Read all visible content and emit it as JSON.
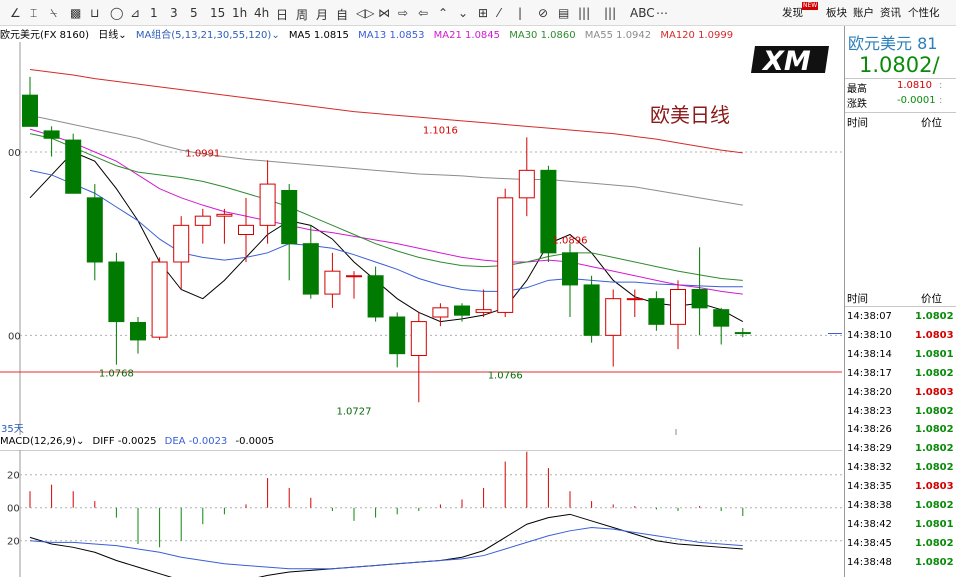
{
  "toolbar": {
    "tools": [
      "∠",
      "⌶",
      "⍀",
      "▩",
      "⊔",
      "◯",
      "⊿",
      "1",
      "3",
      "5",
      "15",
      "1h",
      "4h",
      "日",
      "周",
      "月",
      "自",
      "◁▷",
      "⋈",
      "⇨",
      "⇦",
      "⌃",
      "⌄",
      "⊞",
      "⁄",
      "|",
      "⊘",
      "▤",
      "|||",
      "|||",
      "ABC",
      "⋯"
    ],
    "discover": "发现",
    "badge": "NEW",
    "sectors": "板块",
    "account": "账户",
    "news": "资讯",
    "personal": "个性化"
  },
  "infobar": {
    "symbol": "欧元美元(FX 8160)",
    "period": "日线",
    "ma_group": "MA组合(5,13,21,30,55,120)",
    "ma5": "MA5 1.0815",
    "ma13": "MA13 1.0853",
    "ma21": "MA21 1.0845",
    "ma30": "MA30 1.0860",
    "ma55": "MA55 1.0942",
    "ma120": "MA120 1.0999"
  },
  "watermark": {
    "logo": "XM",
    "title": "欧美日线"
  },
  "macd_header": {
    "label": "MACD(12,26,9)",
    "diff": "DIFF -0.0025",
    "dea": "DEA -0.0023",
    "value": "-0.0005"
  },
  "right_panel": {
    "name": "欧元美元",
    "code_frag": "81",
    "price": "1.0802",
    "high_label": "最高",
    "high_value": "1.0810",
    "change_label": "涨跌",
    "change_value": "-0.0001",
    "header1": {
      "time": "时间",
      "price": "价位"
    },
    "header2": {
      "time": "时间",
      "price": "价位"
    },
    "ticks": [
      {
        "time": "14:38:07",
        "price": "1.0802"
      },
      {
        "time": "14:38:10",
        "price": "1.0803"
      },
      {
        "time": "14:38:14",
        "price": "1.0801"
      },
      {
        "time": "14:38:17",
        "price": "1.0802"
      },
      {
        "time": "14:38:20",
        "price": "1.0803"
      },
      {
        "time": "14:38:23",
        "price": "1.0802"
      },
      {
        "time": "14:38:26",
        "price": "1.0802"
      },
      {
        "time": "14:38:29",
        "price": "1.0802"
      },
      {
        "time": "14:38:32",
        "price": "1.0802"
      },
      {
        "time": "14:38:35",
        "price": "1.0803"
      },
      {
        "time": "14:38:38",
        "price": "1.0802"
      },
      {
        "time": "14:38:42",
        "price": "1.0801"
      },
      {
        "time": "14:38:45",
        "price": "1.0802"
      },
      {
        "time": "14:38:48",
        "price": "1.0802"
      }
    ]
  },
  "colors": {
    "up": "#d40000",
    "down": "#007a00",
    "ma5": "#000000",
    "ma13": "#3a5fd6",
    "ma21": "#d21ad2",
    "ma30": "#2e8b2e",
    "ma55": "#8c8c8c",
    "ma120": "#d42a2a",
    "grid": "#b0b0b0",
    "support": "#e03030"
  },
  "chart_data": [
    {
      "type": "candlestick",
      "title": "欧美日线",
      "y_axis_tick_labels": [
        "00",
        "00"
      ],
      "count_label": "35天",
      "support_level": 1.076,
      "annotations": [
        {
          "index": 8,
          "value": 1.0991,
          "label": "1.0991",
          "pos": "above"
        },
        {
          "index": 19,
          "value": 1.1016,
          "label": "1.1016",
          "pos": "above"
        },
        {
          "index": 25,
          "value": 1.0896,
          "label": "1.0896",
          "pos": "above"
        },
        {
          "index": 4,
          "value": 1.0768,
          "label": "1.0768",
          "pos": "below"
        },
        {
          "index": 15,
          "value": 1.0727,
          "label": "1.0727",
          "pos": "below"
        },
        {
          "index": 22,
          "value": 1.0766,
          "label": "1.0766",
          "pos": "below"
        }
      ],
      "candles": [
        {
          "o": 1.1062,
          "h": 1.1082,
          "l": 1.1028,
          "c": 1.1028
        },
        {
          "o": 1.1023,
          "h": 1.1028,
          "l": 1.0995,
          "c": 1.1015
        },
        {
          "o": 1.1013,
          "h": 1.102,
          "l": 1.0955,
          "c": 1.0955
        },
        {
          "o": 1.095,
          "h": 1.0965,
          "l": 1.086,
          "c": 1.088
        },
        {
          "o": 1.088,
          "h": 1.089,
          "l": 1.0768,
          "c": 1.0815
        },
        {
          "o": 1.0814,
          "h": 1.082,
          "l": 1.078,
          "c": 1.0795
        },
        {
          "o": 1.0798,
          "h": 1.0885,
          "l": 1.0795,
          "c": 1.088
        },
        {
          "o": 1.088,
          "h": 1.093,
          "l": 1.085,
          "c": 1.092
        },
        {
          "o": 1.092,
          "h": 1.0938,
          "l": 1.09,
          "c": 1.093
        },
        {
          "o": 1.093,
          "h": 1.0938,
          "l": 1.09,
          "c": 1.0932
        },
        {
          "o": 1.091,
          "h": 1.095,
          "l": 1.088,
          "c": 1.092
        },
        {
          "o": 1.092,
          "h": 1.0991,
          "l": 1.09,
          "c": 1.0965
        },
        {
          "o": 1.0958,
          "h": 1.0965,
          "l": 1.086,
          "c": 1.09
        },
        {
          "o": 1.09,
          "h": 1.092,
          "l": 1.084,
          "c": 1.0845
        },
        {
          "o": 1.0845,
          "h": 1.089,
          "l": 1.083,
          "c": 1.087
        },
        {
          "o": 1.0865,
          "h": 1.087,
          "l": 1.084,
          "c": 1.0865
        },
        {
          "o": 1.0865,
          "h": 1.0875,
          "l": 1.0815,
          "c": 1.082
        },
        {
          "o": 1.082,
          "h": 1.0825,
          "l": 1.0765,
          "c": 1.078
        },
        {
          "o": 1.0778,
          "h": 1.0825,
          "l": 1.0727,
          "c": 1.0815
        },
        {
          "o": 1.082,
          "h": 1.0835,
          "l": 1.081,
          "c": 1.083
        },
        {
          "o": 1.0832,
          "h": 1.0835,
          "l": 1.0815,
          "c": 1.0822
        },
        {
          "o": 1.0825,
          "h": 1.085,
          "l": 1.082,
          "c": 1.0828
        },
        {
          "o": 1.0825,
          "h": 1.096,
          "l": 1.082,
          "c": 1.095
        },
        {
          "o": 1.095,
          "h": 1.1016,
          "l": 1.093,
          "c": 1.098
        },
        {
          "o": 1.098,
          "h": 1.0985,
          "l": 1.088,
          "c": 1.089
        },
        {
          "o": 1.089,
          "h": 1.09,
          "l": 1.082,
          "c": 1.0855
        },
        {
          "o": 1.0855,
          "h": 1.0865,
          "l": 1.0792,
          "c": 1.08
        },
        {
          "o": 1.08,
          "h": 1.085,
          "l": 1.0766,
          "c": 1.084
        },
        {
          "o": 1.084,
          "h": 1.085,
          "l": 1.082,
          "c": 1.084
        },
        {
          "o": 1.084,
          "h": 1.0848,
          "l": 1.0805,
          "c": 1.0812
        },
        {
          "o": 1.0812,
          "h": 1.086,
          "l": 1.0785,
          "c": 1.085
        },
        {
          "o": 1.085,
          "h": 1.0896,
          "l": 1.08,
          "c": 1.083
        },
        {
          "o": 1.0828,
          "h": 1.083,
          "l": 1.079,
          "c": 1.081
        },
        {
          "o": 1.0803,
          "h": 1.0808,
          "l": 1.0798,
          "c": 1.0802
        }
      ],
      "ma": [
        {
          "name": "MA5",
          "color_key": "ma5",
          "values": [
            1.095,
            1.0975,
            1.1,
            1.099,
            1.096,
            1.0925,
            1.088,
            1.085,
            1.084,
            1.086,
            1.0885,
            1.091,
            1.0925,
            1.092,
            1.0905,
            1.088,
            1.086,
            1.084,
            1.0825,
            1.0815,
            1.0818,
            1.0822,
            1.083,
            1.086,
            1.09,
            1.091,
            1.089,
            1.086,
            1.0842,
            1.0835,
            1.0832,
            1.0835,
            1.0828,
            1.0815
          ]
        },
        {
          "name": "MA13",
          "color_key": "ma13",
          "values": [
            1.098,
            1.0975,
            1.0965,
            1.0955,
            1.094,
            1.0925,
            1.0905,
            1.089,
            1.0885,
            1.0882,
            1.0885,
            1.089,
            1.09,
            1.0898,
            1.0895,
            1.0888,
            1.088,
            1.0872,
            1.0862,
            1.0855,
            1.085,
            1.0848,
            1.0848,
            1.0852,
            1.086,
            1.0862,
            1.086,
            1.0858,
            1.0858,
            1.0856,
            1.0855,
            1.0854,
            1.0853,
            1.0853
          ]
        },
        {
          "name": "MA21",
          "color_key": "ma21",
          "values": [
            1.1025,
            1.1018,
            1.101,
            1.1,
            1.099,
            1.0975,
            1.096,
            1.095,
            1.0942,
            1.0935,
            1.093,
            1.0925,
            1.092,
            1.0915,
            1.0912,
            1.0908,
            1.0904,
            1.09,
            1.0895,
            1.089,
            1.0885,
            1.0882,
            1.088,
            1.088,
            1.0882,
            1.088,
            1.0875,
            1.087,
            1.0865,
            1.086,
            1.0855,
            1.0852,
            1.0848,
            1.0845
          ]
        },
        {
          "name": "MA30",
          "color_key": "ma30",
          "values": [
            1.102,
            1.1015,
            1.1005,
            1.0995,
            1.0985,
            1.0978,
            1.0975,
            1.0972,
            1.0968,
            1.0962,
            1.0955,
            1.0948,
            1.094,
            1.093,
            1.092,
            1.091,
            1.09,
            1.0892,
            1.0885,
            1.088,
            1.0876,
            1.0875,
            1.0876,
            1.088,
            1.0886,
            1.089,
            1.089,
            1.0885,
            1.088,
            1.0875,
            1.087,
            1.0866,
            1.0862,
            1.086
          ]
        },
        {
          "name": "MA55",
          "color_key": "ma55",
          "values": [
            1.104,
            1.1035,
            1.103,
            1.1025,
            1.102,
            1.1015,
            1.1008,
            1.1002,
            1.0998,
            1.0995,
            1.0992,
            1.099,
            1.0988,
            1.0986,
            1.0984,
            1.0982,
            1.098,
            1.0978,
            1.0976,
            1.0975,
            1.0974,
            1.0972,
            1.0971,
            1.097,
            1.097,
            1.0968,
            1.0966,
            1.0964,
            1.0962,
            1.0958,
            1.0954,
            1.095,
            1.0946,
            1.0942
          ]
        },
        {
          "name": "MA120",
          "color_key": "ma120",
          "values": [
            1.109,
            1.1087,
            1.1084,
            1.108,
            1.1077,
            1.1074,
            1.1071,
            1.1068,
            1.1065,
            1.1062,
            1.1059,
            1.1056,
            1.1053,
            1.105,
            1.1047,
            1.1044,
            1.1042,
            1.104,
            1.1038,
            1.1036,
            1.1034,
            1.1032,
            1.103,
            1.1028,
            1.1026,
            1.1024,
            1.1022,
            1.102,
            1.1017,
            1.1014,
            1.101,
            1.1006,
            1.1002,
            1.0999
          ]
        }
      ]
    },
    {
      "type": "bar",
      "title": "MACD(12,26,9)",
      "y_axis_tick_labels": [
        "20",
        "00",
        "20"
      ],
      "y_ticks": [
        0.002,
        0.0,
        -0.002
      ],
      "histogram": [
        0.001,
        0.0014,
        0.001,
        0.0004,
        -0.0006,
        -0.0022,
        -0.0024,
        -0.002,
        -0.001,
        -0.0004,
        0.0002,
        0.0018,
        0.0012,
        0.0006,
        -0.0002,
        -0.0008,
        -0.0006,
        -0.0004,
        -0.0002,
        0.0002,
        0.0005,
        0.0012,
        0.0028,
        0.0034,
        0.0024,
        0.001,
        0.0004,
        0.0002,
        0.0001,
        -0.0001,
        -0.0002,
        0.0001,
        -0.0002,
        -0.0005
      ],
      "diff": [
        -0.0018,
        -0.0022,
        -0.0024,
        -0.0027,
        -0.0032,
        -0.0036,
        -0.004,
        -0.0044,
        -0.0046,
        -0.0046,
        -0.0044,
        -0.0041,
        -0.0039,
        -0.0038,
        -0.0037,
        -0.0036,
        -0.0035,
        -0.0034,
        -0.0033,
        -0.0032,
        -0.003,
        -0.0026,
        -0.0018,
        -0.001,
        -0.0006,
        -0.0004,
        -0.0008,
        -0.0012,
        -0.0016,
        -0.002,
        -0.0022,
        -0.0023,
        -0.0024,
        -0.0025
      ],
      "dea": [
        -0.002,
        -0.0021,
        -0.0021,
        -0.0022,
        -0.0023,
        -0.0025,
        -0.0027,
        -0.003,
        -0.0032,
        -0.0034,
        -0.0035,
        -0.0036,
        -0.0037,
        -0.0037,
        -0.0037,
        -0.0036,
        -0.0035,
        -0.0034,
        -0.0033,
        -0.0032,
        -0.0031,
        -0.0029,
        -0.0025,
        -0.0021,
        -0.0017,
        -0.0014,
        -0.0012,
        -0.0013,
        -0.0015,
        -0.0017,
        -0.0019,
        -0.0021,
        -0.0022,
        -0.0023
      ]
    }
  ]
}
